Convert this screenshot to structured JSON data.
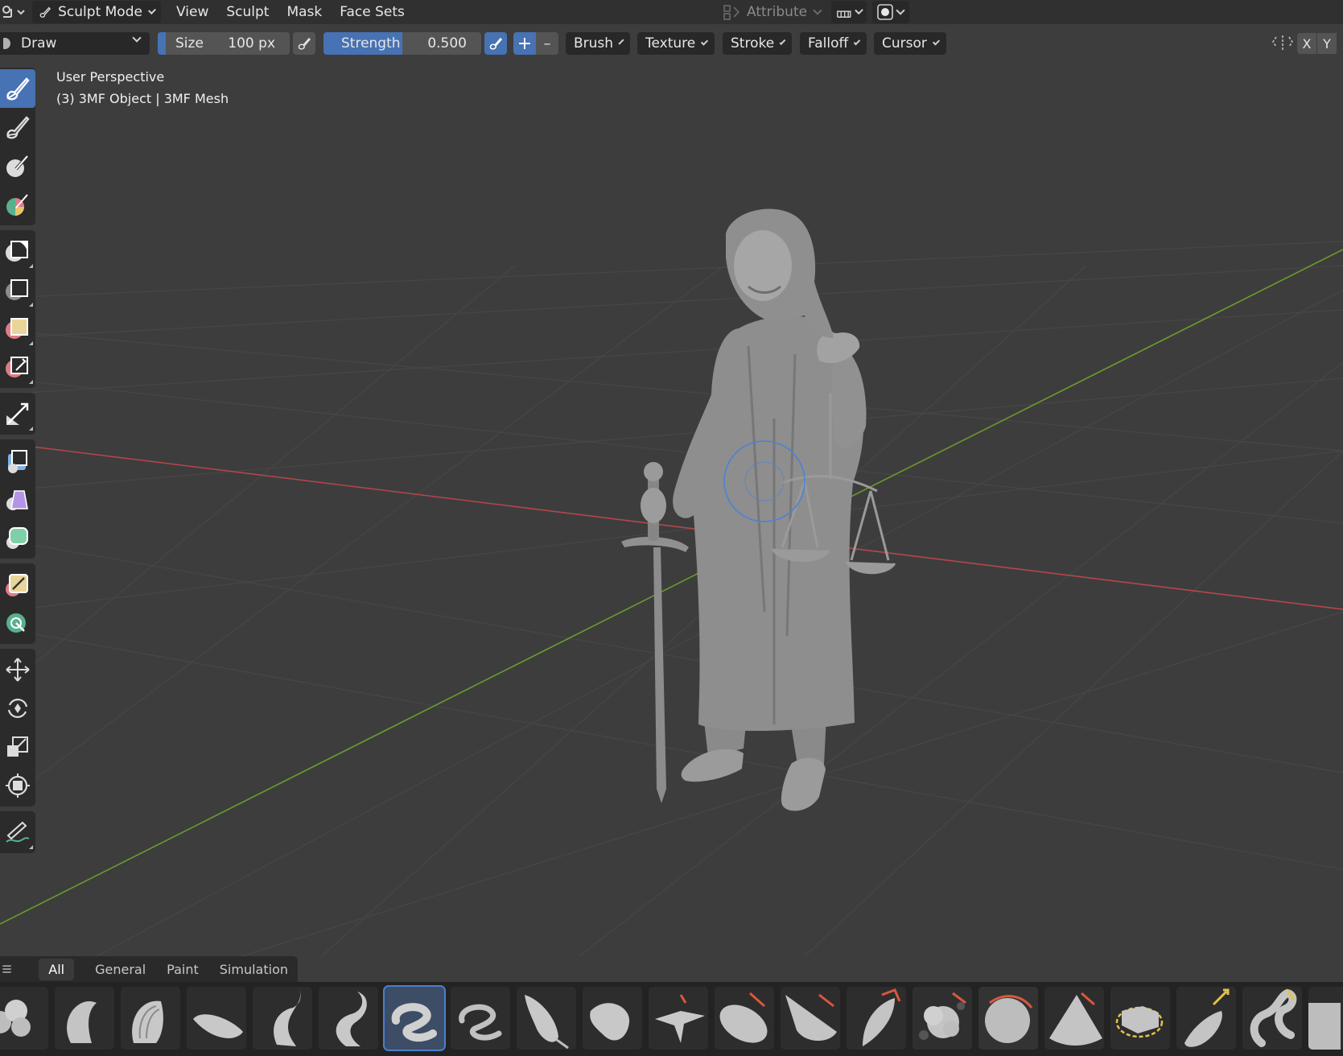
{
  "header": {
    "mode_label": "Sculpt Mode",
    "menus": [
      "View",
      "Sculpt",
      "Mask",
      "Face Sets"
    ],
    "attribute_label": "Attribute"
  },
  "tool_settings": {
    "brush_name": "Draw",
    "size_label": "Size",
    "size_value": "100 px",
    "strength_label": "Strength",
    "strength_value": "0.500",
    "plus_symbol": "+",
    "minus_symbol": "–",
    "popovers": [
      "Brush",
      "Texture",
      "Stroke",
      "Falloff",
      "Cursor"
    ],
    "axis_x": "X",
    "axis_y": "Y"
  },
  "viewport": {
    "view_name": "User Perspective",
    "object_info": "(3) 3MF Object | 3MF Mesh"
  },
  "toolbar": {
    "groups": [
      [
        "draw-brush-icon",
        "paint-brush-icon",
        "mask-brush-icon",
        "face-set-brush-icon"
      ],
      [
        "box-mask-icon",
        "box-hide-icon",
        "box-face-set-icon",
        "box-trim-icon"
      ],
      [
        "line-project-icon"
      ],
      [
        "mesh-filter-icon",
        "cloth-filter-icon",
        "color-filter-icon"
      ],
      [
        "edit-face-set-icon",
        "mask-by-color-icon"
      ],
      [
        "move-icon",
        "rotate-icon",
        "scale-icon",
        "transform-icon"
      ],
      [
        "annotate-icon"
      ]
    ],
    "active": "draw-brush-icon"
  },
  "asset_shelf": {
    "tabs": [
      "All",
      "General",
      "Paint",
      "Simulation"
    ],
    "active_tab": "All",
    "active_index": 6
  },
  "colors": {
    "accent": "#4772b3",
    "x_axis": "#b5474b",
    "y_axis": "#6c9a2e",
    "grid": "#474747",
    "viewport_bg": "#3d3d3d"
  }
}
